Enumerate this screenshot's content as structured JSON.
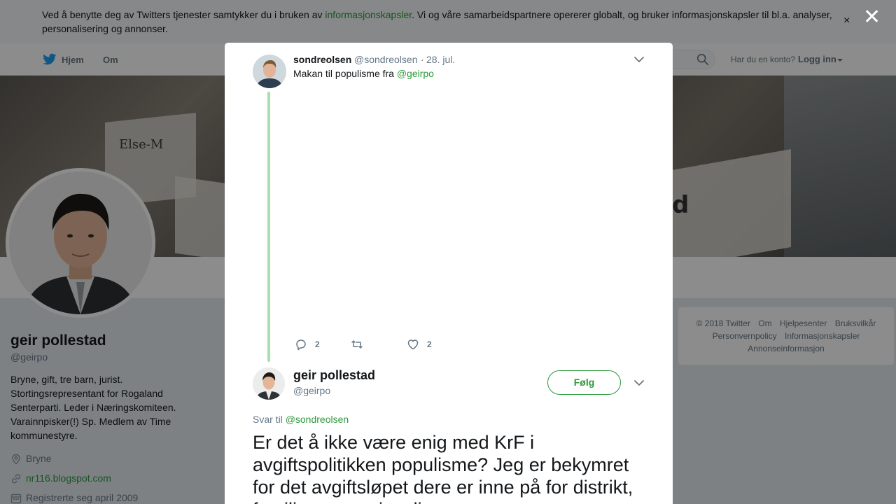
{
  "cookie_banner": {
    "text_before": "Ved å benytte deg av Twitters tjenester samtykker du i bruken av ",
    "link": "informasjonskapsler",
    "text_after": ". Vi og våre samarbeidspartnere opererer globalt, og bruker informasjonskapsler til bl.a. analyser, personalisering og annonser.",
    "close_glyph": "×"
  },
  "nav": {
    "home": "Hjem",
    "about": "Om",
    "account_question": "Har du en konto?",
    "login": "Logg inn"
  },
  "header": {
    "photo_label_1": "Else-M",
    "photo_label_2": "d"
  },
  "profile": {
    "name": "geir pollestad",
    "handle": "@geirpo",
    "bio": "Bryne, gift, tre barn, jurist. Stortingsrepresentant for Rogaland Senterparti. Leder i Næringskomiteen. Varainnpisker(!) Sp. Medlem av Time kommunestyre.",
    "location": "Bryne",
    "website": "nr116.blogspot.com",
    "joined": "Registrerte seg april 2009"
  },
  "footer": {
    "links": [
      "© 2018 Twitter",
      "Om",
      "Hjelpesenter",
      "Bruksvilkår",
      "Personvernpolicy",
      "Informasjonskapsler",
      "Annonseinformasjon"
    ]
  },
  "modal": {
    "close_glyph": "✕",
    "parent_tweet": {
      "name": "sondreolsen",
      "handle": "@sondreolsen",
      "separator": "·",
      "date": "28. jul.",
      "text": "Makan til populisme fra ",
      "mention": "@geirpo",
      "reply_count": "2",
      "retweet_count": "",
      "like_count": "2"
    },
    "main_tweet": {
      "name": "geir pollestad",
      "handle": "@geirpo",
      "follow_label": "Følg",
      "reply_to_label": "Svar til",
      "reply_to_mention": "@sondreolsen",
      "text": "Er det å ikke være enig med KrF i avgiftspolitikken populisme? Jeg er bekymret for det avgiftsløpet dere er inne på for distrikt, familier og næringsliv"
    }
  },
  "colors": {
    "accent": "#2b9a3a",
    "thread_line": "#a8dfb0",
    "secondary_text": "#657786"
  }
}
